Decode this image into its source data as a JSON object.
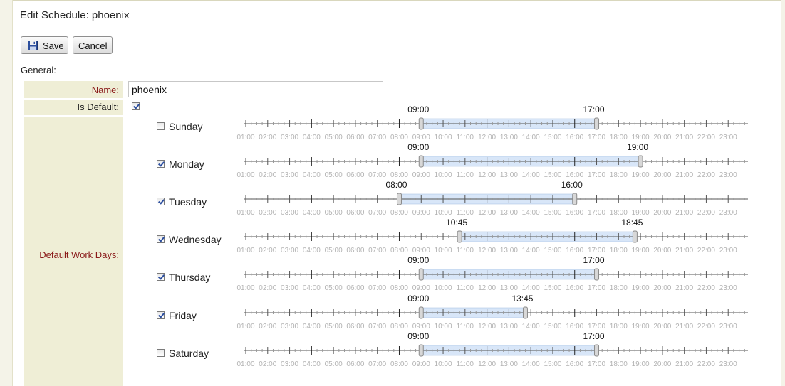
{
  "title": "Edit Schedule: phoenix",
  "toolbar": {
    "save_label": "Save",
    "cancel_label": "Cancel"
  },
  "section": "General:",
  "fields": {
    "name_label": "Name:",
    "name_value": "phoenix",
    "is_default_label": "Is Default:",
    "is_default_checked": true,
    "work_days_label": "Default Work Days:"
  },
  "hour_labels": [
    "01:00",
    "02:00",
    "03:00",
    "04:00",
    "05:00",
    "06:00",
    "07:00",
    "08:00",
    "09:00",
    "10:00",
    "11:00",
    "12:00",
    "13:00",
    "14:00",
    "15:00",
    "16:00",
    "17:00",
    "18:00",
    "19:00",
    "20:00",
    "21:00",
    "22:00",
    "23:00"
  ],
  "colors": {
    "range_fill": "#d8e6f8",
    "range_border": "#9fbbe0",
    "label_red": "#8a1a1a",
    "panel_bg": "#efeed6"
  },
  "days": [
    {
      "name": "Sunday",
      "checked": false,
      "start": "09:00",
      "end": "17:00"
    },
    {
      "name": "Monday",
      "checked": true,
      "start": "09:00",
      "end": "19:00"
    },
    {
      "name": "Tuesday",
      "checked": true,
      "start": "08:00",
      "end": "16:00"
    },
    {
      "name": "Wednesday",
      "checked": true,
      "start": "10:45",
      "end": "18:45"
    },
    {
      "name": "Thursday",
      "checked": true,
      "start": "09:00",
      "end": "17:00"
    },
    {
      "name": "Friday",
      "checked": true,
      "start": "09:00",
      "end": "13:45"
    },
    {
      "name": "Saturday",
      "checked": false,
      "start": "09:00",
      "end": "17:00"
    }
  ]
}
